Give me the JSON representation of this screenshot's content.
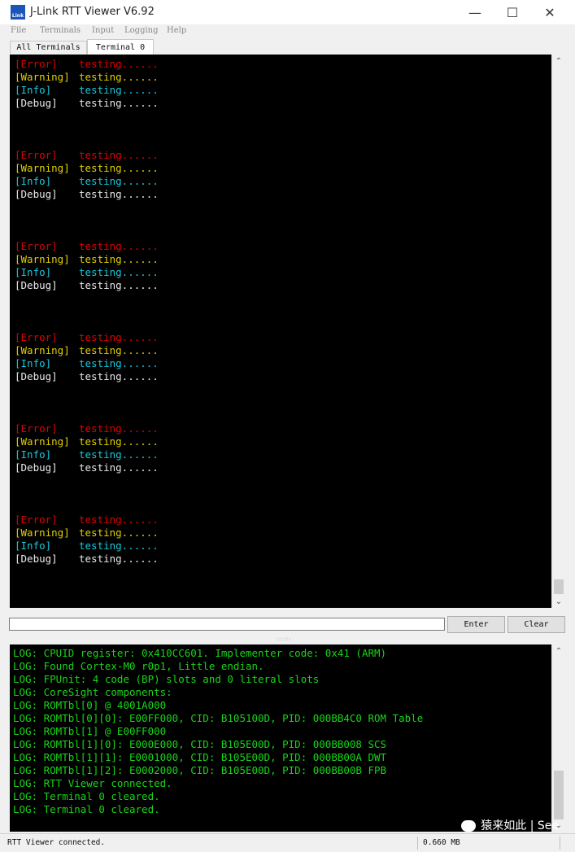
{
  "window": {
    "title": "J-Link RTT Viewer V6.92",
    "icon_label": "Link",
    "minimize_glyph": "—",
    "maximize_glyph": "☐",
    "close_glyph": "✕"
  },
  "menu": [
    "File",
    "Terminals",
    "Input",
    "Logging",
    "Help"
  ],
  "tabs": [
    {
      "label": "All Terminals",
      "active": false
    },
    {
      "label": "Terminal 0",
      "active": true
    }
  ],
  "terminal": {
    "background": "#000000",
    "tag_colors": {
      "Error": "#e00000",
      "Warning": "#e0d000",
      "Info": "#18c8d8",
      "Debug": "#e8e8e8"
    },
    "blocks": [
      [
        {
          "tag": "[Error]",
          "level": "Error",
          "message": "testing......"
        },
        {
          "tag": "[Warning]",
          "level": "Warning",
          "message": "testing......"
        },
        {
          "tag": "[Info]",
          "level": "Info",
          "message": "testing......"
        },
        {
          "tag": "[Debug]",
          "level": "Debug",
          "message": "testing......"
        }
      ],
      [
        {
          "tag": "[Error]",
          "level": "Error",
          "message": "testing......"
        },
        {
          "tag": "[Warning]",
          "level": "Warning",
          "message": "testing......"
        },
        {
          "tag": "[Info]",
          "level": "Info",
          "message": "testing......"
        },
        {
          "tag": "[Debug]",
          "level": "Debug",
          "message": "testing......"
        }
      ],
      [
        {
          "tag": "[Error]",
          "level": "Error",
          "message": "testing......"
        },
        {
          "tag": "[Warning]",
          "level": "Warning",
          "message": "testing......"
        },
        {
          "tag": "[Info]",
          "level": "Info",
          "message": "testing......"
        },
        {
          "tag": "[Debug]",
          "level": "Debug",
          "message": "testing......"
        }
      ],
      [
        {
          "tag": "[Error]",
          "level": "Error",
          "message": "testing......"
        },
        {
          "tag": "[Warning]",
          "level": "Warning",
          "message": "testing......"
        },
        {
          "tag": "[Info]",
          "level": "Info",
          "message": "testing......"
        },
        {
          "tag": "[Debug]",
          "level": "Debug",
          "message": "testing......"
        }
      ],
      [
        {
          "tag": "[Error]",
          "level": "Error",
          "message": "testing......"
        },
        {
          "tag": "[Warning]",
          "level": "Warning",
          "message": "testing......"
        },
        {
          "tag": "[Info]",
          "level": "Info",
          "message": "testing......"
        },
        {
          "tag": "[Debug]",
          "level": "Debug",
          "message": "testing......"
        }
      ],
      [
        {
          "tag": "[Error]",
          "level": "Error",
          "message": "testing......"
        },
        {
          "tag": "[Warning]",
          "level": "Warning",
          "message": "testing......"
        },
        {
          "tag": "[Info]",
          "level": "Info",
          "message": "testing......"
        },
        {
          "tag": "[Debug]",
          "level": "Debug",
          "message": "testing......"
        }
      ]
    ]
  },
  "input": {
    "value": "",
    "enter_label": "Enter",
    "clear_label": "Clear"
  },
  "log": {
    "color": "#19d519",
    "lines": [
      "LOG: CPUID register: 0x410CC601. Implementer code: 0x41 (ARM)",
      "LOG: Found Cortex-M0 r0p1, Little endian.",
      "LOG: FPUnit: 4 code (BP) slots and 0 literal slots",
      "LOG: CoreSight components:",
      "LOG: ROMTbl[0] @ 4001A000",
      "LOG: ROMTbl[0][0]: E00FF000, CID: B105100D, PID: 000BB4C0 ROM Table",
      "LOG: ROMTbl[1] @ E00FF000",
      "LOG: ROMTbl[1][0]: E000E000, CID: B105E00D, PID: 000BB008 SCS",
      "LOG: ROMTbl[1][1]: E0001000, CID: B105E00D, PID: 000BB00A DWT",
      "LOG: ROMTbl[1][2]: E0002000, CID: B105E00D, PID: 000BB00B FPB",
      "LOG: RTT Viewer connected.",
      "LOG: Terminal 0 cleared.",
      "LOG: Terminal 0 cleared."
    ]
  },
  "watermark": "猿来如此 | See",
  "status": {
    "message": "RTT Viewer connected.",
    "memory": "0.660 MB"
  }
}
